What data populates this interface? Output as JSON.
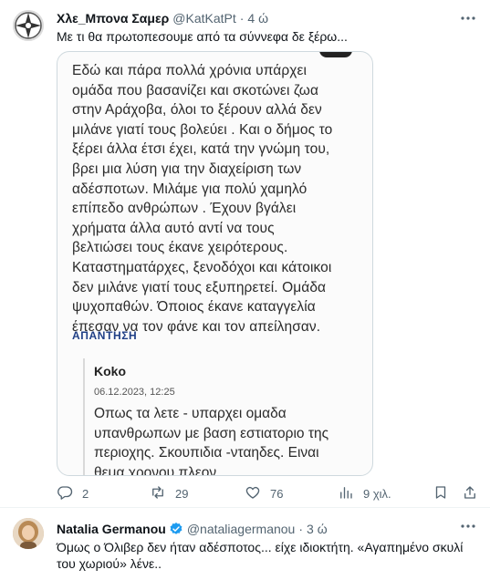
{
  "tweet1": {
    "author_name": "Χλε_Μπονα Σαμερ",
    "handle": "@KatKatPt",
    "separator": "·",
    "time": "4 ώ",
    "text": "Με τι θα πρωτοπεσουμε από τα σύννεφα δε ξέρω...",
    "media": {
      "comment_lines": [
        "Εδώ και πάρα πολλά χρόνια υπάρχει",
        "ομάδα που βασανίζει και σκοτώνει ζωα",
        "στην Αράχοβα, όλοι το ξέρουν αλλά δεν",
        "μιλάνε γιατί τους βολεύει . Και ο δήμος το",
        "ξέρει άλλα έτσι έχει, κατά την γνώμη του,",
        "βρει μια λύση για την διαχείριση των",
        "αδέσποτων. Μιλάμε για πολύ χαμηλό",
        "επίπεδο ανθρώπων . Έχουν βγάλει",
        "χρήματα άλλα αυτό αντί να τους",
        "βελτιώσει τους έκανε χειρότερους.",
        "Καταστηματάρχες, ξενοδόχοι και κάτοικοι",
        "δεν μιλάνε γιατί τους εξυπηρετεί. Ομάδα",
        "ψυχοπαθών. Όποιος έκανε καταγγελία",
        "έπεσαν να τον φάνε και τον απείλησαν."
      ],
      "reply_label": "ΑΠΑΝΤΗΣΗ",
      "reply": {
        "author": "Koko",
        "date": "06.12.2023, 12:25",
        "lines": [
          "Οπως τα λετε - υπαρχει ομαδα",
          "υπανθρωπων με βαση εστιατοριο της",
          "περιοχης. Σκουπιδια -νταηδες. Ειναι",
          "θεμα χρονου πλεον"
        ]
      }
    },
    "actions": {
      "replies": "2",
      "retweets": "29",
      "likes": "76",
      "views": "9 χιλ."
    }
  },
  "tweet2": {
    "author_name": "Natalia Germanou",
    "handle": "@nataliagermanou",
    "separator": "·",
    "time": "3 ώ",
    "text": "Όμως ο Όλιβερ δεν ήταν αδέσποτος... είχε ιδιοκτήτη. «Αγαπημένο σκυλί του χωριού» λένε.."
  },
  "colors": {
    "text": "#0f1419",
    "secondary": "#536471",
    "verified": "#1d9bf0",
    "reply_link": "#1f3f86"
  }
}
